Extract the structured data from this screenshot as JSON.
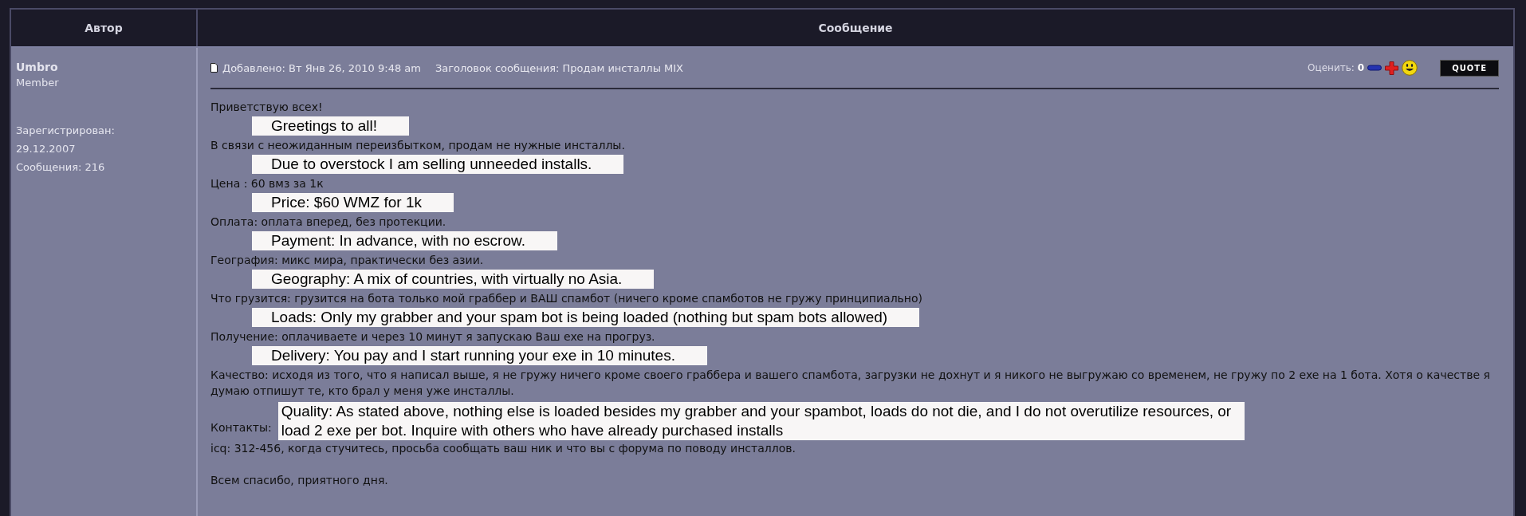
{
  "table": {
    "columns": [
      "Автор",
      "Сообщение"
    ]
  },
  "author": {
    "name": "Umbro",
    "rank": "Member",
    "registered_label": "Зарегистрирован:",
    "registered_date": "29.12.2007",
    "posts": "Сообщения: 216"
  },
  "post": {
    "added": "Добавлено: Вт Янв 26, 2010 9:48 am",
    "subject": "Заголовок сообщения: Продам инсталлы MIX",
    "rate_label": "Оценить:",
    "rate_value": "0",
    "quote_button": "QUOTE",
    "lines": [
      {
        "kind": "original",
        "text": "Приветствую всех!"
      },
      {
        "kind": "translation",
        "text": "Greetings to all!"
      },
      {
        "kind": "original",
        "text": "В связи с неожиданным переизбытком, продам не нужные инсталлы."
      },
      {
        "kind": "translation",
        "text": "Due to overstock I am selling unneeded installs."
      },
      {
        "kind": "original",
        "text": "Цена : 60 вмз за 1к"
      },
      {
        "kind": "translation",
        "text": "Price: $60 WMZ for 1k"
      },
      {
        "kind": "original",
        "text": "Оплата: оплата вперед, без протекции."
      },
      {
        "kind": "translation",
        "text": "Payment: In advance, with no escrow."
      },
      {
        "kind": "original",
        "text": "География: микс мира, практически без азии."
      },
      {
        "kind": "translation",
        "text": "Geography: A mix of countries, with virtually no Asia."
      },
      {
        "kind": "original",
        "text": "Что грузится: грузится на бота только мой граббер и ВАШ спамбот (ничего кроме спамботов не гружу принципиально)"
      },
      {
        "kind": "translation",
        "text": "Loads: Only my grabber and your spam bot is being loaded (nothing but spam bots allowed)"
      },
      {
        "kind": "original",
        "text": "Получение: оплачиваете и через 10 минут я запускаю Ваш exe на прогруз."
      },
      {
        "kind": "translation",
        "text": "Delivery: You pay and I start running your exe in 10 minutes."
      },
      {
        "kind": "original",
        "text": "Качество: исходя из того, что я написал выше, я не гружу ничего кроме своего граббера и вашего спамбота, загрузки не дохнут и я никого не выгружаю со временем, не гружу по 2 exe на 1 бота. Хотя о качестве я думаю отпишут те, кто брал у меня уже инсталлы."
      },
      {
        "kind": "labeled_translation",
        "label": "Контакты:",
        "text": "Quality: As stated above, nothing else is loaded besides my grabber and your spambot, loads do not die, and I do not overutilize resources, or load 2 exe per bot. Inquire with others who have already purchased installs"
      },
      {
        "kind": "original",
        "text": "icq: 312-456, когда стучитесь, просьба сообщать ваш ник и что вы с форума по поводу инсталлов."
      },
      {
        "kind": "blank"
      },
      {
        "kind": "original",
        "text": "Всем спасибо, приятного дня."
      }
    ]
  }
}
